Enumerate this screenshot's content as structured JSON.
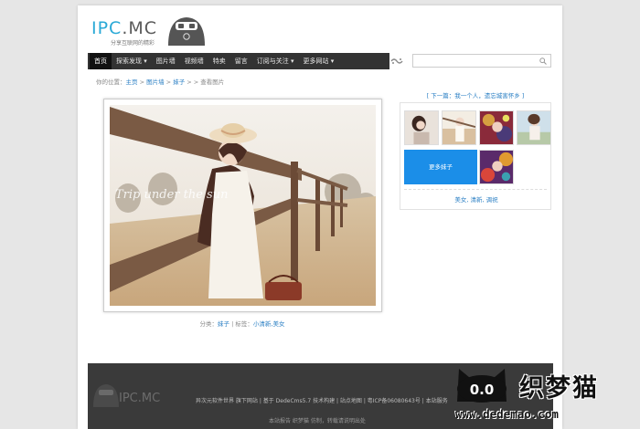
{
  "header": {
    "logo_prefix": "IPC",
    "logo_suffix": ".MC",
    "logo_tagline": "分享互联网的精彩"
  },
  "nav": {
    "items": [
      {
        "label": "首页",
        "active": true
      },
      {
        "label": "探索发现 ▾"
      },
      {
        "label": "图片墙"
      },
      {
        "label": "视频墙"
      },
      {
        "label": "特卖"
      },
      {
        "label": "留言"
      },
      {
        "label": "订阅与关注 ▾"
      },
      {
        "label": "更多网站 ▾"
      }
    ]
  },
  "search": {
    "value": "",
    "placeholder": ""
  },
  "breadcrumb": {
    "prefix": "你的位置：",
    "home": "主页",
    "sep1": " > ",
    "section": "图片墙",
    "sep2": " > ",
    "category": "妹子",
    "tail": " > > 查看图片"
  },
  "photo": {
    "overlay_text": "Trip under the sun"
  },
  "photo_meta": {
    "category_label": "分类：",
    "category": "妹子",
    "separator": "  |  ",
    "tags_label": "标签：",
    "tags": "小清新,美女"
  },
  "sidebar": {
    "next_link": "[ 下一篇：我一个人，遗忘城害怀乡 ]",
    "more_button": "更多妹子",
    "tags": "美女, 清新, 调祝"
  },
  "footer": {
    "logo_prefix": "IPC",
    "logo_suffix": ".MC",
    "links": "异次元软件世界 旗下网站 | 基于 DedeCms5.7 技术构建 | 站点地图 | 粤ICP备06080643号 | 本站服务",
    "copyright": "本站报告 织梦猫 仿制，转载请说明出处"
  },
  "watermark": {
    "cat_face": "0.0",
    "title": "织梦猫",
    "url": "www.dedemao.com"
  },
  "colors": {
    "accent_blue": "#2aa9d6",
    "link_blue": "#2a7fc4",
    "nav_bg": "#333333",
    "button_blue": "#1b8ee8",
    "footer_bg": "#3a3a3a"
  }
}
